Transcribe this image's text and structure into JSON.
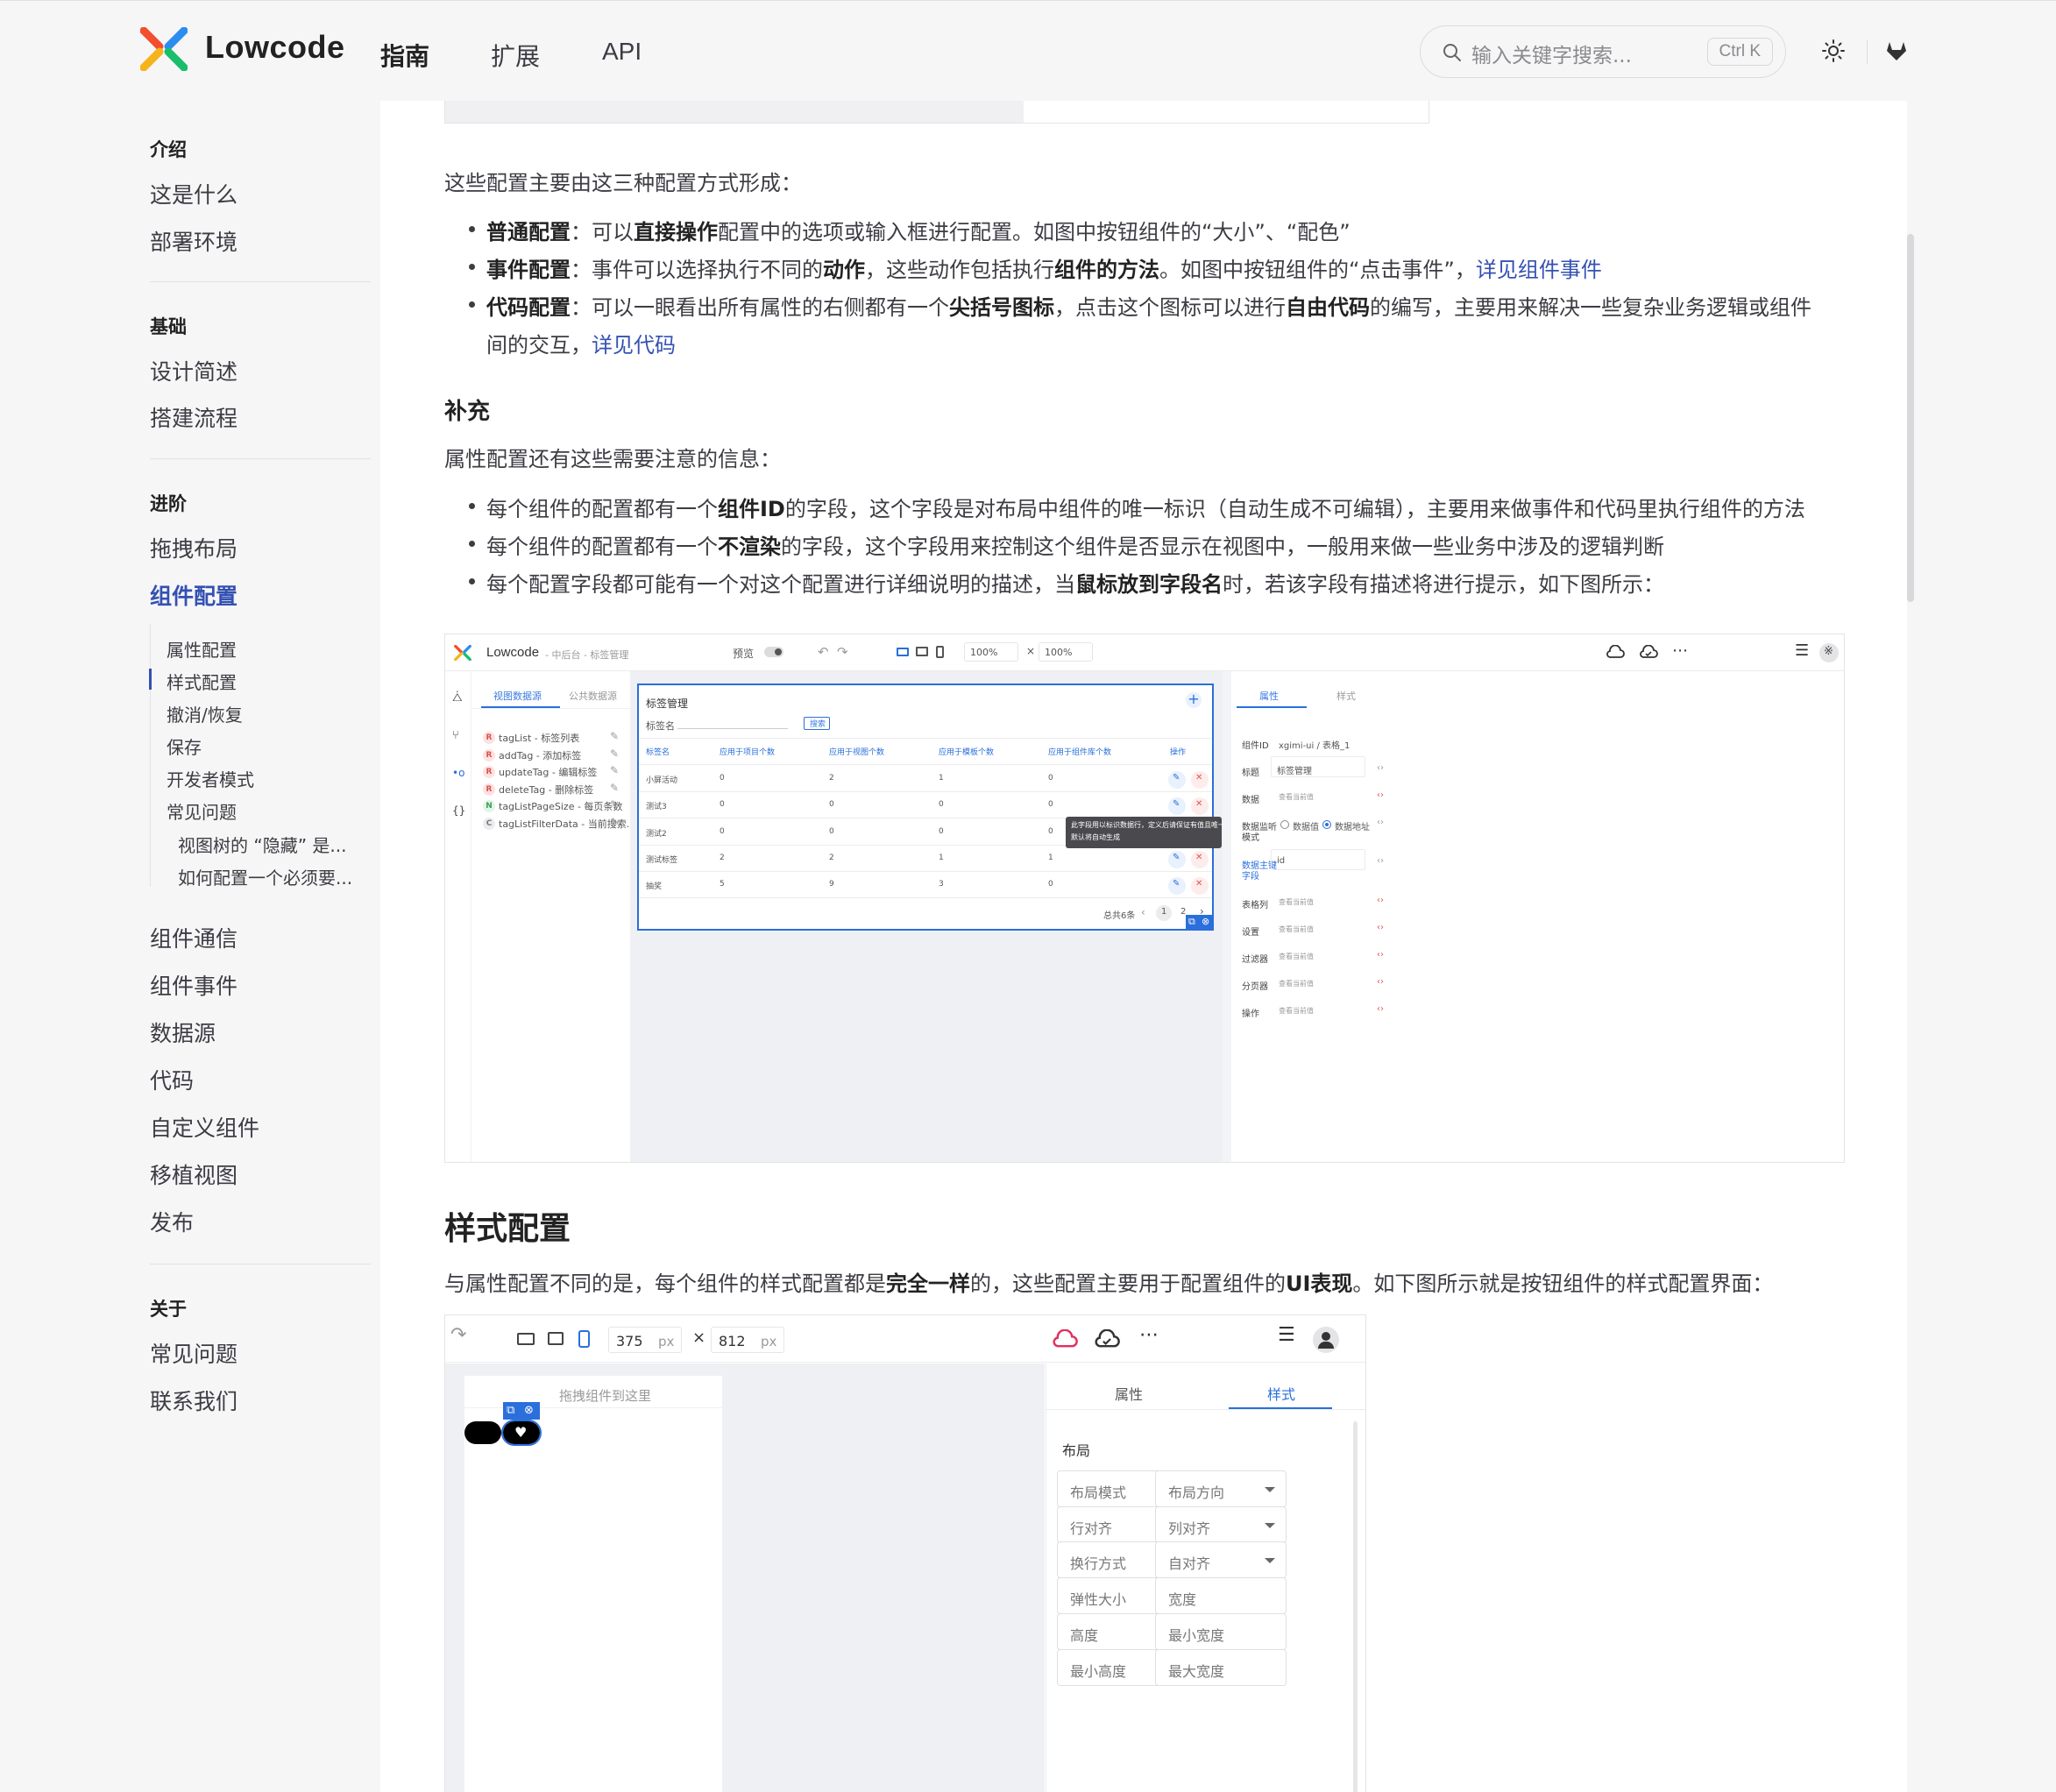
{
  "nav": {
    "brand": "Lowcode",
    "links": [
      "指南",
      "扩展",
      "API"
    ],
    "search_placeholder": "输入关键字搜索...",
    "search_shortcut": "Ctrl K"
  },
  "sidebar": {
    "groups": [
      {
        "title": "介绍",
        "items": [
          "这是什么",
          "部署环境"
        ]
      },
      {
        "title": "基础",
        "items": [
          "设计简述",
          "搭建流程"
        ]
      },
      {
        "title": "进阶",
        "items": [
          "拖拽布局",
          "组件配置"
        ]
      },
      {
        "title": "关于",
        "items": [
          "常见问题",
          "联系我们"
        ]
      }
    ],
    "active": "组件配置",
    "sub_items": [
      "属性配置",
      "样式配置",
      "撤消/恢复",
      "保存",
      "开发者模式",
      "常见问题"
    ],
    "subsub_items": [
      "视图树的 “隐藏” 是...",
      "如何配置一个必须要..."
    ],
    "more_items": [
      "组件通信",
      "组件事件",
      "数据源",
      "代码",
      "自定义组件",
      "移植视图",
      "发布"
    ]
  },
  "content": {
    "intro": "这些配置主要由这三种配置方式形成：",
    "b1": {
      "t1": "普通配置",
      "t2": "：可以",
      "t3": "直接操作",
      "t4": "配置中的选项或输入框进行配置。如图中按钮组件的“大小”、“配色”"
    },
    "b2": {
      "t1": "事件配置",
      "t2": "：事件可以选择执行不同的",
      "t3": "动作",
      "t4": "，这些动作包括执行",
      "t5": "组件的方法",
      "t6": "。如图中按钮组件的“点击事件”，",
      "link": "详见组件事件"
    },
    "b3": {
      "t1": "代码配置",
      "t2": "：可以一眼看出所有属性的右侧都有一个",
      "t3": "尖括号图标",
      "t4": "，点击这个图标可以进行",
      "t5": "自由代码",
      "t6": "的编写，主要用来解决一些复杂业务逻辑或组件",
      "t7": "间的交互，",
      "link": "详见代码"
    },
    "supplement_title": "补充",
    "supplement_intro": "属性配置还有这些需要注意的信息：",
    "s1": {
      "t1": "每个组件的配置都有一个",
      "t2": "组件ID",
      "t3": "的字段，这个字段是对布局中组件的唯一标识（自动生成不可编辑），主要用来做事件和代码里执行组件的方法"
    },
    "s2": {
      "t1": "每个组件的配置都有一个",
      "t2": "不渲染",
      "t3": "的字段，这个字段用来控制这个组件是否显示在视图中，一般用来做一些业务中涉及的逻辑判断"
    },
    "s3": {
      "t1": "每个配置字段都可能有一个对这个配置进行详细说明的描述，当",
      "t2": "鼠标放到字段名",
      "t3": "时，若该字段有描述将进行提示，如下图所示："
    },
    "style_title": "样式配置",
    "style_p": {
      "t1": "与属性配置不同的是，每个组件的样式配置都是",
      "t2": "完全一样",
      "t3": "的，这些配置主要用于配置组件的",
      "t4": "UI表现",
      "t5": "。如下图所示就是按钮组件的样式配置界面："
    }
  },
  "shot1": {
    "brand": "Lowcode",
    "crumb": "- 中后台 - 标签管理",
    "preview": "预览",
    "zoom1": "100%",
    "zoom2": "100%",
    "tabs": [
      "视图数据源",
      "公共数据源"
    ],
    "sources": [
      {
        "badge": "R",
        "label": "tagList - 标签列表"
      },
      {
        "badge": "R",
        "label": "addTag - 添加标签"
      },
      {
        "badge": "R",
        "label": "updateTag - 编辑标签"
      },
      {
        "badge": "R",
        "label": "deleteTag - 删除标签"
      },
      {
        "badge": "N",
        "label": "tagListPageSize - 每页条数"
      },
      {
        "badge": "C",
        "label": "tagListFilterData - 当前搜索..."
      }
    ],
    "table_title": "标签管理",
    "filter_label": "标签名",
    "search_btn": "搜索",
    "columns": [
      "标签名",
      "应用于项目个数",
      "应用于视图个数",
      "应用于模板个数",
      "应用于组件库个数",
      "操作"
    ],
    "rows": [
      [
        "小屏活动",
        "0",
        "2",
        "1",
        "0"
      ],
      [
        "测试3",
        "0",
        "0",
        "0",
        "0"
      ],
      [
        "测试2",
        "0",
        "0",
        "0",
        "0"
      ],
      [
        "测试标签",
        "2",
        "2",
        "1",
        "1"
      ],
      [
        "抽奖",
        "5",
        "9",
        "3",
        "0"
      ]
    ],
    "total": "总共6条",
    "pages": [
      "1",
      "2"
    ],
    "tooltip": [
      "此字段用以标识数据行，定义后请保证有值且唯一",
      "默认将自动生成"
    ],
    "right_tabs": [
      "属性",
      "样式"
    ],
    "props": [
      {
        "label": "组件ID",
        "value": "xgimi-ui / 表格_1"
      },
      {
        "label": "标题",
        "value": "标签管理"
      },
      {
        "label": "数据",
        "value": "查看当前值"
      },
      {
        "label": "数据监听",
        "label2": "模式",
        "opt1": "数据值",
        "opt2": "数据地址"
      },
      {
        "label": "数据主键",
        "label2": "字段",
        "value": "id"
      },
      {
        "label": "表格列",
        "value": "查看当前值"
      },
      {
        "label": "设置",
        "value": "查看当前值"
      },
      {
        "label": "过滤器",
        "value": "查看当前值"
      },
      {
        "label": "分页器",
        "value": "查看当前值"
      },
      {
        "label": "操作",
        "value": "查看当前值"
      }
    ]
  },
  "shot2": {
    "width": "375",
    "height": "812",
    "unit": "px",
    "times": "×",
    "drop_hint": "拖拽组件到这里",
    "tabs": [
      "属性",
      "样式"
    ],
    "section": "布局",
    "fields": [
      [
        "布局模式",
        "布局方向"
      ],
      [
        "行对齐",
        "列对齐"
      ],
      [
        "换行方式",
        "自对齐"
      ],
      [
        "弹性大小",
        "宽度"
      ],
      [
        "高度",
        "最小宽度"
      ],
      [
        "最小高度",
        "最大宽度"
      ]
    ]
  },
  "colors": {
    "brand": "#3451b2",
    "accent": "#2a6fdb",
    "text": "#3c3c43"
  }
}
